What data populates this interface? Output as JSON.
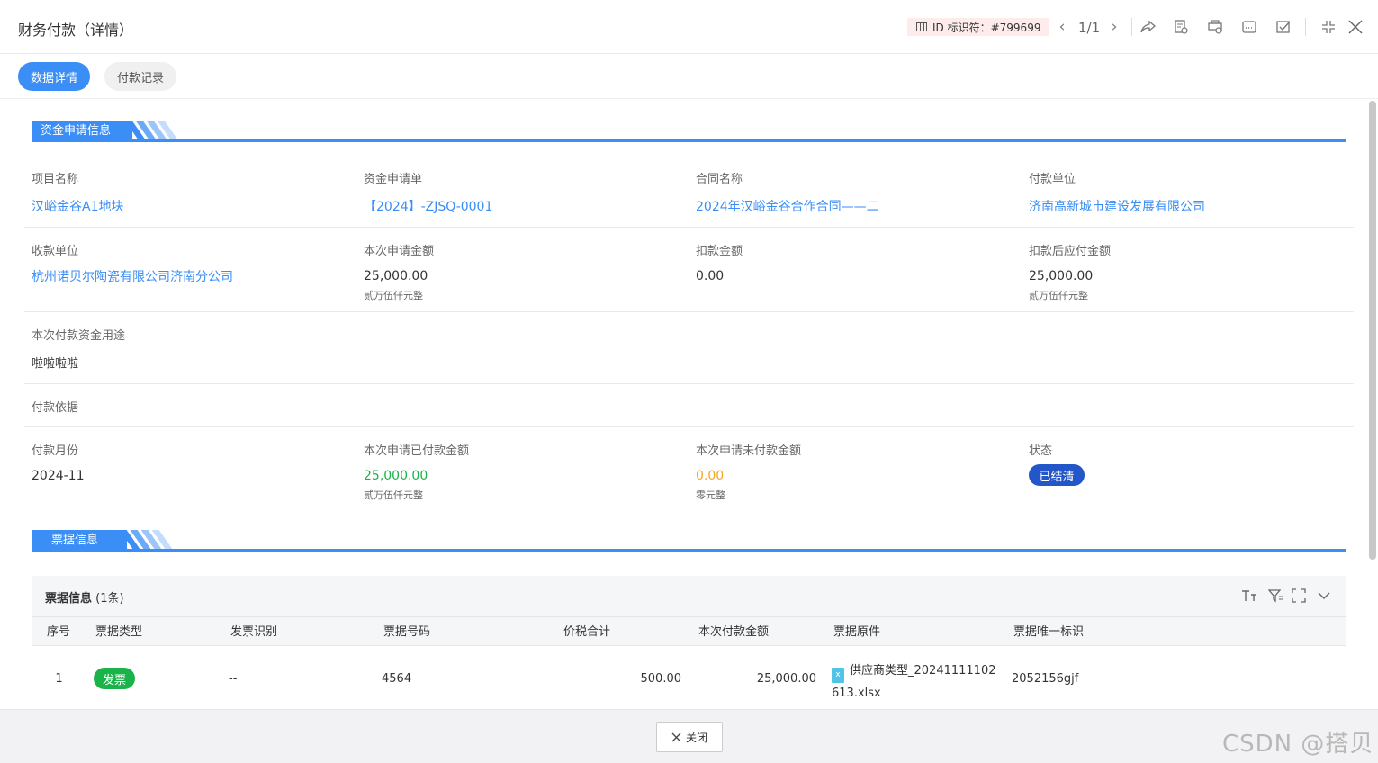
{
  "header": {
    "title": "财务付款（详情）",
    "id_badge": "ID 标识符：#799699",
    "pager": "1/1"
  },
  "tabs": [
    {
      "label": "数据详情",
      "active": true
    },
    {
      "label": "付款记录",
      "active": false
    }
  ],
  "sections": {
    "fund": "资金申请信息",
    "invoice": "票据信息"
  },
  "fields": {
    "project_name": {
      "label": "项目名称",
      "value": "汉峪金谷A1地块"
    },
    "fund_request": {
      "label": "资金申请单",
      "value": "【2024】-ZJSQ-0001"
    },
    "contract_name": {
      "label": "合同名称",
      "value": "2024年汉峪金谷合作合同——二"
    },
    "payer": {
      "label": "付款单位",
      "value": "济南高新城市建设发展有限公司"
    },
    "payee": {
      "label": "收款单位",
      "value": "杭州诺贝尔陶瓷有限公司济南分公司"
    },
    "request_amount": {
      "label": "本次申请金额",
      "value": "25,000.00",
      "words": "贰万伍仟元整"
    },
    "deduction": {
      "label": "扣款金额",
      "value": "0.00"
    },
    "payable_after": {
      "label": "扣款后应付金额",
      "value": "25,000.00",
      "words": "贰万伍仟元整"
    },
    "purpose": {
      "label": "本次付款资金用途",
      "value": "啦啦啦啦"
    },
    "basis": {
      "label": "付款依据"
    },
    "pay_month": {
      "label": "付款月份",
      "value": "2024-11"
    },
    "paid_amount": {
      "label": "本次申请已付款金额",
      "value": "25,000.00",
      "words": "贰万伍仟元整"
    },
    "unpaid_amount": {
      "label": "本次申请未付款金额",
      "value": "0.00",
      "words": "零元整"
    },
    "status": {
      "label": "状态",
      "value": "已结清"
    }
  },
  "invoice_table": {
    "title": "票据信息",
    "count": "(1条)",
    "columns": [
      "序号",
      "票据类型",
      "发票识别",
      "票据号码",
      "价税合计",
      "本次付款金额",
      "票据原件",
      "票据唯一标识"
    ],
    "rows": [
      {
        "index": "1",
        "type": "发票",
        "recognize": "--",
        "number": "4564",
        "total": "500.00",
        "pay_amount": "25,000.00",
        "file_line1": "供应商类型_20241111102",
        "file_line2": "613.xlsx",
        "file_icon": "x",
        "unique_id": "2052156gjf"
      }
    ]
  },
  "footer": {
    "close_label": "关闭"
  },
  "watermark": "CSDN @搭贝",
  "colors": {
    "accent": "#3a8ef6",
    "status_settled": "#2357c9",
    "green": "#19b34a",
    "orange": "#f5a623"
  }
}
